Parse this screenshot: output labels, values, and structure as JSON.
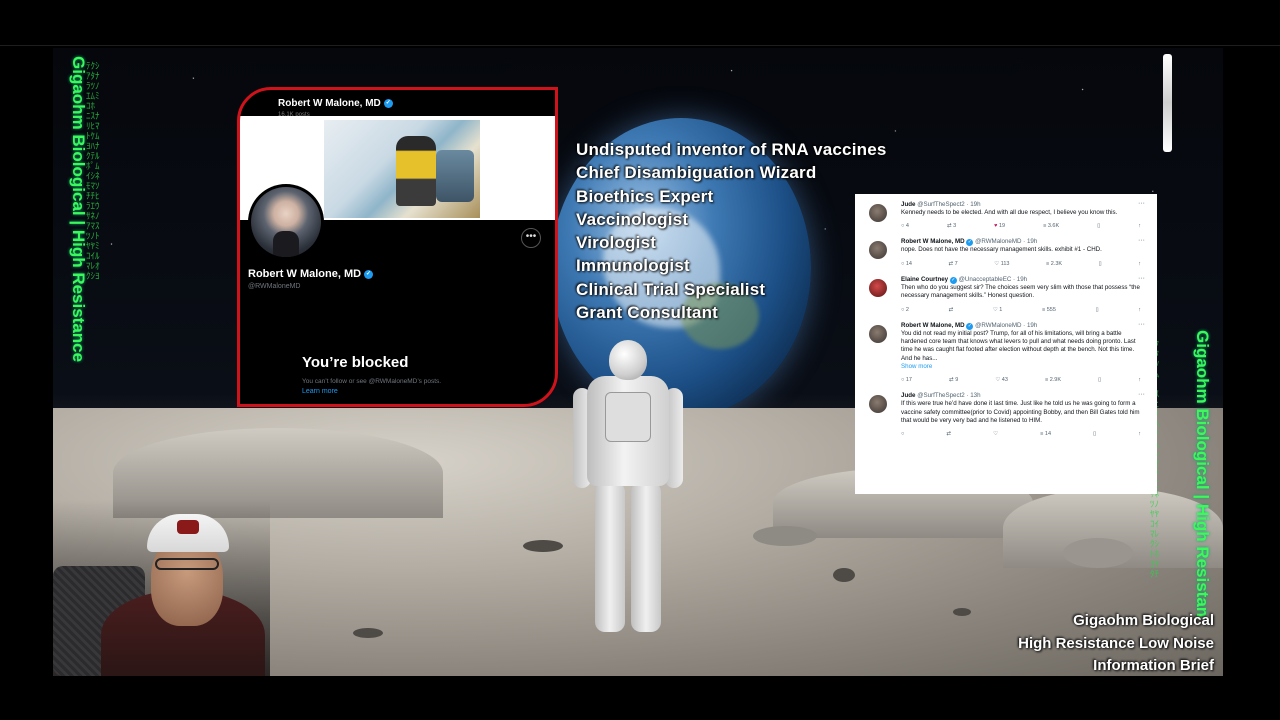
{
  "profile": {
    "header_name": "Robert W Malone, MD",
    "header_posts": "16.1K posts",
    "name": "Robert W Malone, MD",
    "handle": "@RWMaloneMD",
    "more_label": "•••",
    "blocked_title": "You’re blocked",
    "blocked_subtitle": "You can’t follow or see @RWMaloneMD’s posts.",
    "learn_more": "Learn more",
    "verified_glyph": "✓",
    "border_color": "#d0121b",
    "accent_color": "#1d9bf0"
  },
  "titles": [
    "Undisputed inventor of RNA vaccines",
    "Chief Disambiguation Wizard",
    "Bioethics Expert",
    "Vaccinologist",
    "Virologist",
    "Immunologist",
    "Clinical Trial Specialist",
    "Grant Consultant"
  ],
  "replies": [
    {
      "name": "Jude",
      "meta": "@SurfTheSpect2 · 19h",
      "body": "Kennedy needs to be elected. And with all due respect, I believe you know this.",
      "more": "",
      "actions": {
        "reply": "4",
        "repost": "3",
        "like": "19",
        "views": "3.6K"
      }
    },
    {
      "name": "Robert W Malone, MD",
      "meta": "@RWMaloneMD · 19h",
      "body": "nope.  Does not have the necessary management skills.  exhibit #1 - CHD.",
      "more": "",
      "actions": {
        "reply": "14",
        "repost": "7",
        "like": "113",
        "views": "2.3K"
      }
    },
    {
      "name": "Elaine Courtney",
      "meta": "@UnacceptableEC · 19h",
      "body": "Then who do you suggest sir? The choices seem very slim with those that possess “the necessary management skills.” Honest question.",
      "more": "",
      "actions": {
        "reply": "2",
        "repost": "",
        "like": "1",
        "views": "555"
      }
    },
    {
      "name": "Robert W Malone, MD",
      "meta": "@RWMaloneMD · 19h",
      "body": "You did not read my initial post?  Trump, for all of his limitations, will bring a battle hardened core team that knows what levers to pull and what needs doing pronto.  Last time he was caught flat footed after election without depth at the bench.  Not this time.  And he has...",
      "more": "Show more",
      "actions": {
        "reply": "17",
        "repost": "9",
        "like": "43",
        "views": "2.9K"
      }
    },
    {
      "name": "Jude",
      "meta": "@SurfTheSpect2 · 13h",
      "body": "If this were true he’d have done it last time. Just like he told us he was going to form a vaccine safety committee(prior to Covid) appointing Bobby, and then Bill Gates told him that would be very very bad and he listened to HIM.",
      "more": "",
      "actions": {
        "reply": "",
        "repost": "",
        "like": "",
        "views": "14"
      }
    }
  ],
  "icons": {
    "reply": "○",
    "repost": "⇄",
    "like": "♡",
    "like_filled": "♥",
    "views": "≡",
    "bookmark": "▯",
    "share": "↑",
    "dots": "···"
  },
  "ticker": {
    "left": "Gigaohm Biological | High Resistance",
    "right": "Gigaohm Biological | High Resistan"
  },
  "brand": {
    "line1": "Gigaohm Biological",
    "line2": "High Resistance Low Noise",
    "line3": "Information Brief"
  },
  "colors": {
    "ticker_green": "#3cf85a",
    "background": "#000000"
  }
}
